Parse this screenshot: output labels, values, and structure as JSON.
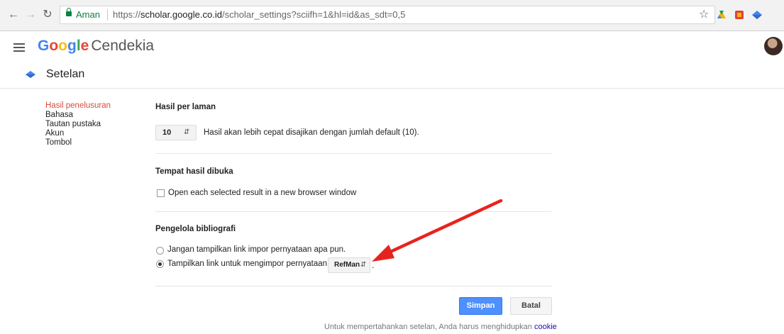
{
  "browser": {
    "secure_label": "Aman",
    "url_prefix": "https://",
    "url_host": "scholar.google.co.id",
    "url_path": "/scholar_settings?sciifh=1&hl=id&as_sdt=0,5",
    "star_icon": "bookmark-star-icon",
    "extension_colors": [
      "#4285f4",
      "#db4437",
      "#f4b400",
      "#4285f4"
    ]
  },
  "header": {
    "logo_letters": [
      {
        "ch": "G",
        "color": "#4285f4"
      },
      {
        "ch": "o",
        "color": "#ea4335"
      },
      {
        "ch": "o",
        "color": "#fbbc05"
      },
      {
        "ch": "g",
        "color": "#4285f4"
      },
      {
        "ch": "l",
        "color": "#34a853"
      },
      {
        "ch": "e",
        "color": "#ea4335"
      }
    ],
    "product_name": "Cendekia"
  },
  "subbar": {
    "title": "Setelan"
  },
  "sidebar": {
    "items": [
      {
        "label": "Hasil penelusuran",
        "active": true
      },
      {
        "label": "Bahasa",
        "active": false
      },
      {
        "label": "Tautan pustaka",
        "active": false
      },
      {
        "label": "Akun",
        "active": false
      },
      {
        "label": "Tombol",
        "active": false
      }
    ]
  },
  "settings": {
    "results_per_page": {
      "title": "Hasil per laman",
      "value": "10",
      "description": "Hasil akan lebih cepat disajikan dengan jumlah default (10)."
    },
    "open_results": {
      "title": "Tempat hasil dibuka",
      "checkbox_label": "Open each selected result in a new browser window",
      "checked": false
    },
    "bibliography": {
      "title": "Pengelola bibliografi",
      "option_none": "Jangan tampilkan link impor pernyataan apa pun.",
      "option_show": "Tampilkan link untuk mengimpor pernyataan ke",
      "selected_manager": "RefMan",
      "trailing": ".",
      "selected_option": "show"
    }
  },
  "actions": {
    "save_label": "Simpan",
    "cancel_label": "Batal"
  },
  "footer": {
    "note": "Untuk mempertahankan setelan, Anda harus menghidupkan",
    "cookie_link": "cookie"
  },
  "annotation": {
    "arrow_color": "#e8231f"
  }
}
